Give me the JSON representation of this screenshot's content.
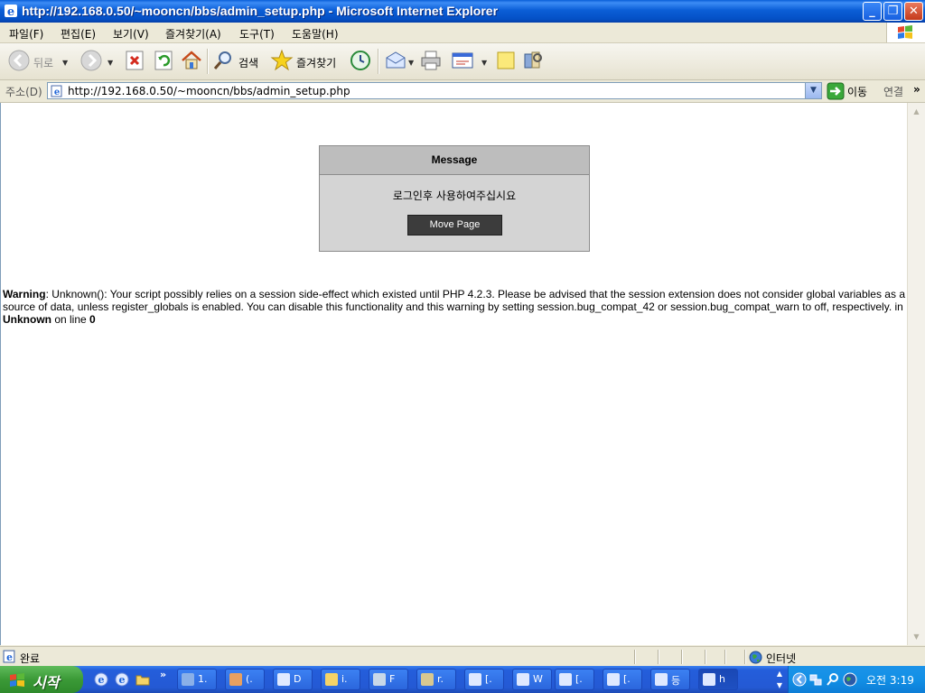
{
  "window": {
    "title": "http://192.168.0.50/~mooncn/bbs/admin_setup.php - Microsoft Internet Explorer",
    "min_label": "_",
    "max_label": "❐",
    "close_label": "✕"
  },
  "menu": {
    "items": [
      "파일(F)",
      "편집(E)",
      "보기(V)",
      "즐겨찾기(A)",
      "도구(T)",
      "도움말(H)"
    ]
  },
  "toolbar": {
    "back_label": "뒤로",
    "search_label": "검색",
    "favorites_label": "즐겨찾기"
  },
  "address": {
    "label": "주소(D)",
    "url": "http://192.168.0.50/~mooncn/bbs/admin_setup.php",
    "go_label": "이동",
    "links_label": "연결",
    "links_chevron": "»"
  },
  "message_box": {
    "header": "Message",
    "text": "로그인후 사용하여주십시요",
    "button_label": "Move Page"
  },
  "warning": {
    "label": "Warning",
    "body": ": Unknown(): Your script possibly relies on a session side-effect which existed until PHP 4.2.3. Please be advised that the session extension does not consider global variables as a source of data, unless register_globals is enabled. You can disable this functionality and this warning by setting session.bug_compat_42 or session.bug_compat_warn to off, respectively. in ",
    "location": "Unknown",
    "line_prefix": " on line ",
    "line": "0"
  },
  "status": {
    "text": "완료",
    "zone": "인터넷"
  },
  "taskbar": {
    "start_label": "시작",
    "tasks": [
      "1.",
      "(.",
      "D",
      "i.",
      "F",
      "r.",
      "[.",
      "W",
      "[.",
      "[.",
      "등",
      "h"
    ],
    "clock": "오전 3:19",
    "chevron": "»"
  },
  "colors": {
    "titlebar": "#0b5ed7",
    "taskbar": "#245edb",
    "start_button": "#3b9a37",
    "message_header": "#bdbdbd",
    "message_body": "#d4d4d4",
    "move_button": "#3c3c3c"
  }
}
